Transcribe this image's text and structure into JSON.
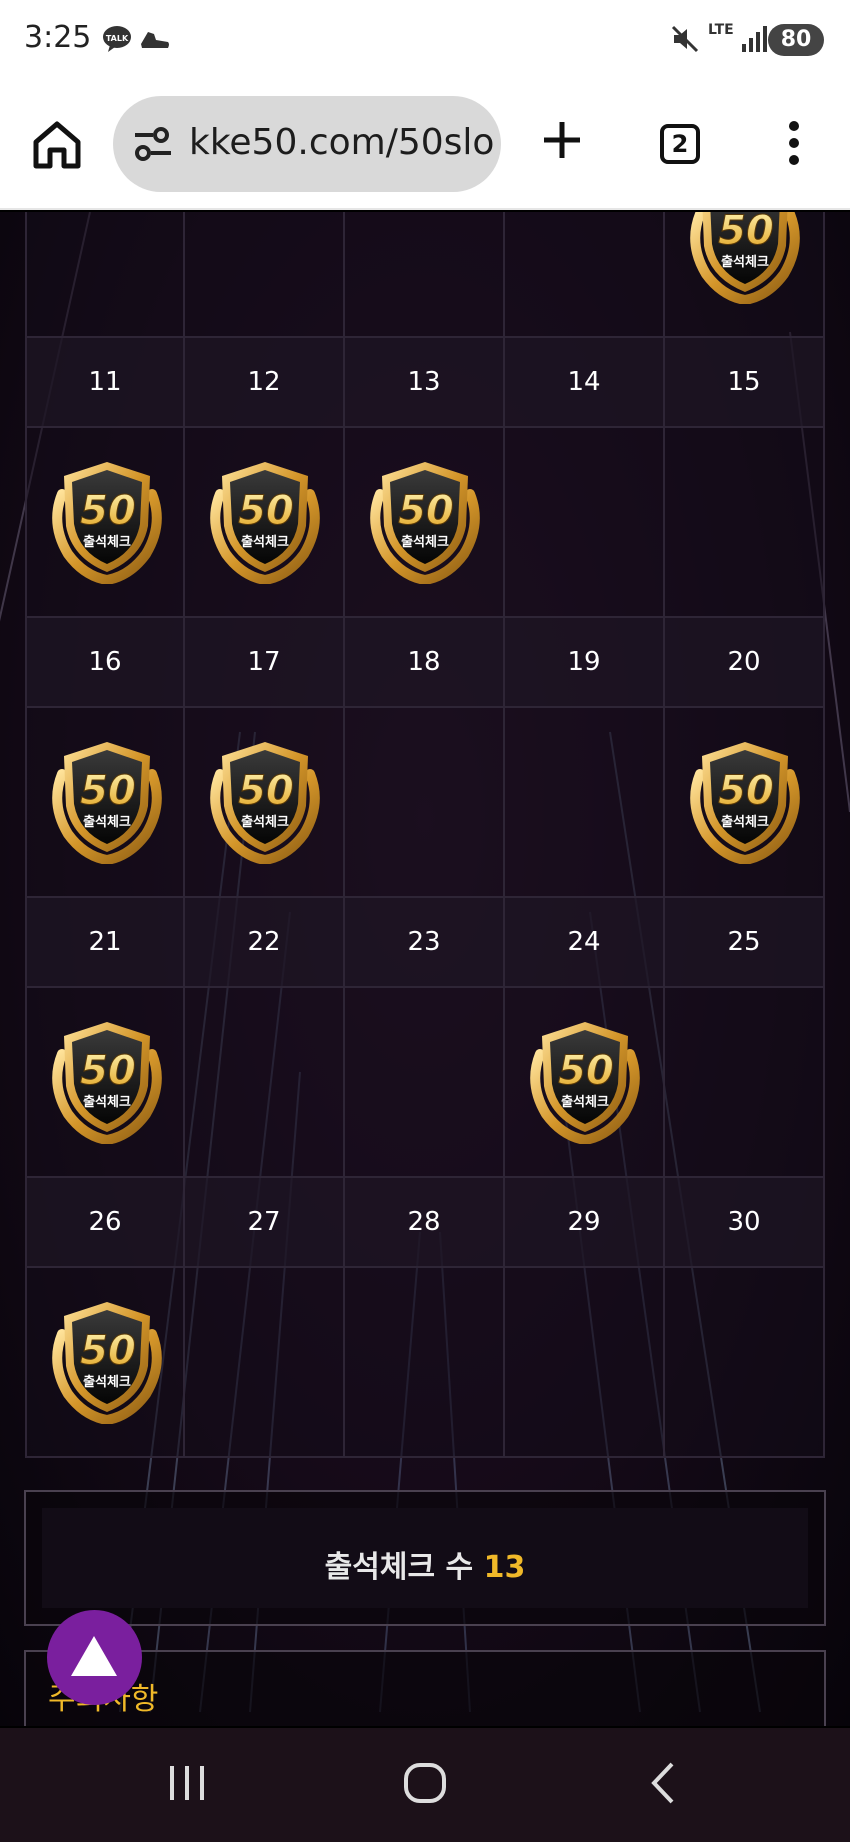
{
  "status_bar": {
    "time": "3:25",
    "talk_icon_text": "TALK",
    "network": "LTE",
    "battery": "80"
  },
  "browser": {
    "url": "kke50.com/50slo",
    "tab_count": "2"
  },
  "calendar": {
    "weeks": [
      {
        "days": [
          "",
          "",
          "",
          "",
          ""
        ],
        "checked": [
          false,
          false,
          false,
          false,
          true
        ]
      },
      {
        "days": [
          "11",
          "12",
          "13",
          "14",
          "15"
        ],
        "checked": [
          true,
          true,
          true,
          false,
          false
        ]
      },
      {
        "days": [
          "16",
          "17",
          "18",
          "19",
          "20"
        ],
        "checked": [
          true,
          true,
          false,
          false,
          true
        ]
      },
      {
        "days": [
          "21",
          "22",
          "23",
          "24",
          "25"
        ],
        "checked": [
          true,
          false,
          false,
          true,
          false
        ]
      },
      {
        "days": [
          "26",
          "27",
          "28",
          "29",
          "30"
        ],
        "checked": [
          true,
          false,
          false,
          false,
          false
        ]
      }
    ],
    "badge_number": "50",
    "badge_label": "출석체크"
  },
  "summary": {
    "label": "출석체크 수",
    "count": "13"
  },
  "notice": {
    "title": "주의사항"
  },
  "colors": {
    "accent": "#f0b929",
    "scroll_button": "#7a1f9e"
  }
}
